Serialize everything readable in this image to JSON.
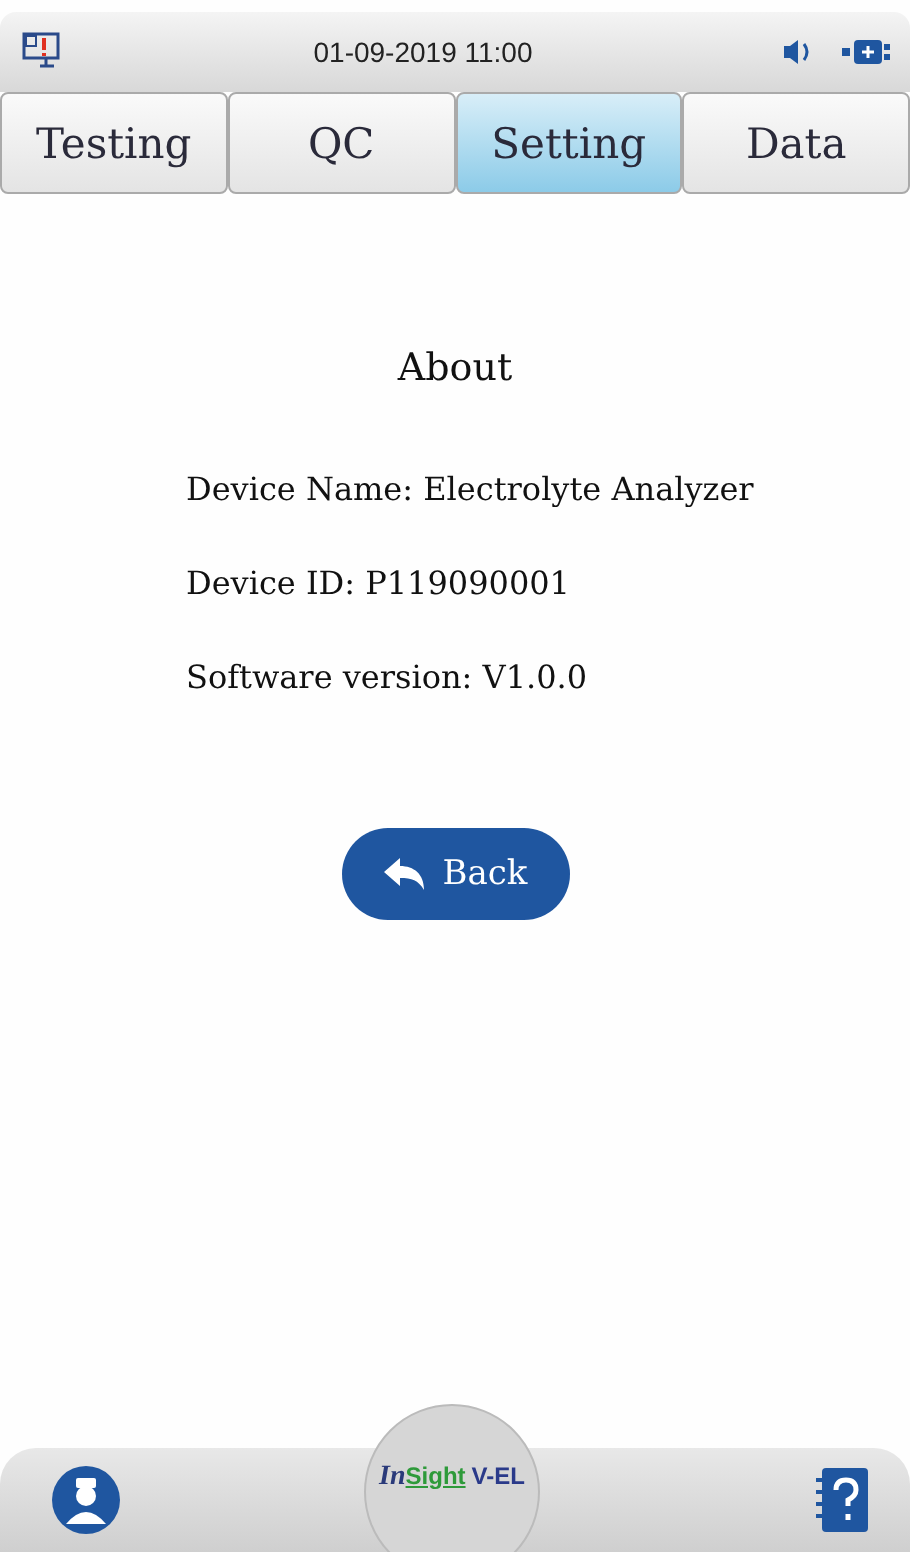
{
  "status_bar": {
    "datetime": "01-09-2019  11:00",
    "alert": true
  },
  "tabs": [
    {
      "label": "Testing",
      "selected": false
    },
    {
      "label": "QC",
      "selected": false
    },
    {
      "label": "Setting",
      "selected": true
    },
    {
      "label": "Data",
      "selected": false
    }
  ],
  "page": {
    "title": "About",
    "lines": [
      "Device Name: Electrolyte Analyzer",
      "Device ID: P119090001",
      "Software version: V1.0.0"
    ],
    "back_button": "Back"
  },
  "logo": {
    "prefix": "In",
    "name": "Sight",
    "model": "V-EL"
  }
}
